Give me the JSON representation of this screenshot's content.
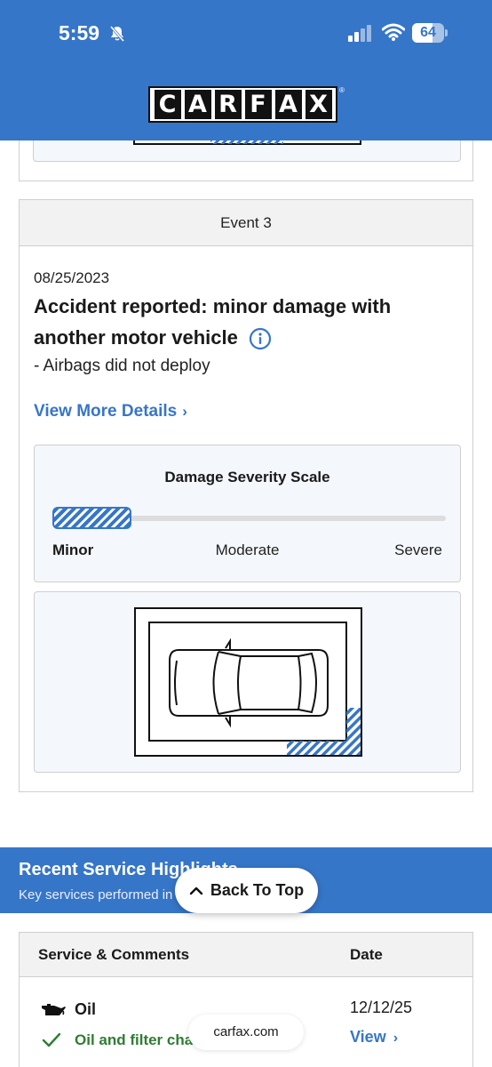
{
  "status_bar": {
    "time": "5:59",
    "battery": "64",
    "battery_level_percent": 64
  },
  "brand": {
    "logo_letters": [
      "C",
      "A",
      "R",
      "F",
      "A",
      "X"
    ],
    "registered_mark": "®"
  },
  "event": {
    "header": "Event 3",
    "date": "08/25/2023",
    "title": "Accident reported: minor damage with another motor vehicle",
    "detail": "- Airbags did not deploy",
    "view_more_label": "View More Details",
    "severity": {
      "title": "Damage Severity Scale",
      "level_fraction": 0.2,
      "labels": {
        "minor": "Minor",
        "moderate": "Moderate",
        "severe": "Severe"
      }
    }
  },
  "service": {
    "banner_title": "Recent Service Highlights",
    "banner_subtitle": "Key services performed in",
    "back_to_top_label": "Back To Top",
    "table": {
      "col_service": "Service & Comments",
      "col_date": "Date",
      "rows": [
        {
          "label": "Oil",
          "description": "Oil and filter cha",
          "date": "12/12/25",
          "action": "View"
        }
      ]
    }
  },
  "browser": {
    "url": "carfax.com"
  },
  "colors": {
    "brand_blue": "#3676c9",
    "success_green": "#2e7d32",
    "panel_bg": "#f4f7fb"
  }
}
